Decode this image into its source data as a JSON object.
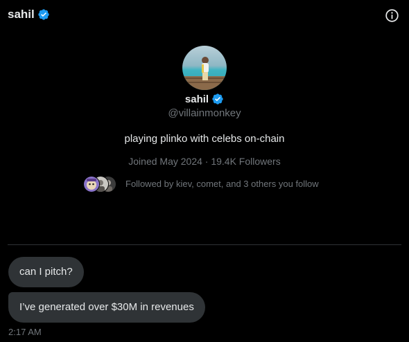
{
  "header": {
    "name": "sahil",
    "verified_icon": "verified-badge-icon",
    "info_icon": "info-icon"
  },
  "profile": {
    "name": "sahil",
    "handle": "@villainmonkey",
    "bio": "playing plinko with celebs on-chain",
    "meta": "Joined May 2024 · 19.4K Followers",
    "followed_by": "Followed by kiev, comet, and 3 others you follow"
  },
  "messages": [
    {
      "text": "can I pitch?"
    },
    {
      "text": "I’ve generated over $30M in revenues"
    }
  ],
  "timestamp": "2:17 AM",
  "colors": {
    "background": "#000000",
    "bubble": "#2f3336",
    "text_primary": "#e7e9ea",
    "text_secondary": "#71767b",
    "verified": "#1d9bf0",
    "divider": "#2f3336"
  }
}
